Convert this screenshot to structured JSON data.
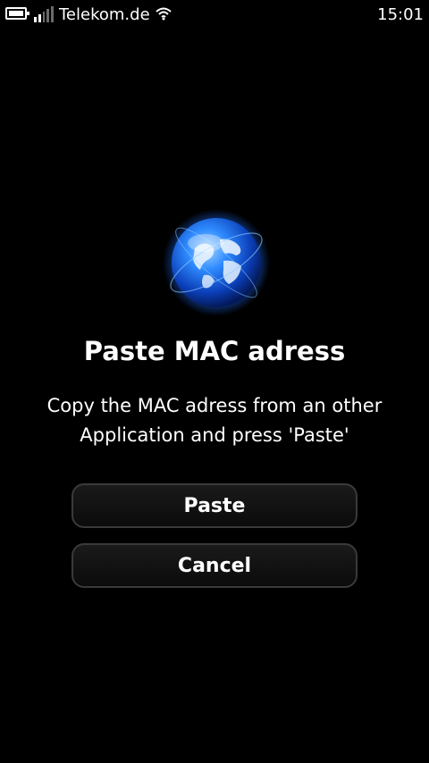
{
  "status_bar": {
    "operator": "Telekom.de",
    "time": "15:01",
    "battery_icon": "battery-icon",
    "signal_icon": "signal-strength-icon",
    "wifi_icon": "wifi-icon"
  },
  "dialog": {
    "icon": "globe-icon",
    "title": "Paste MAC adress",
    "message_line1": "Copy the MAC adress from an other",
    "message_line2": "Application and press 'Paste'",
    "paste_label": "Paste",
    "cancel_label": "Cancel"
  },
  "colors": {
    "background": "#000000",
    "text": "#ffffff",
    "globe_blue": "#1e6fff",
    "button_border": "#3a3a3a"
  }
}
